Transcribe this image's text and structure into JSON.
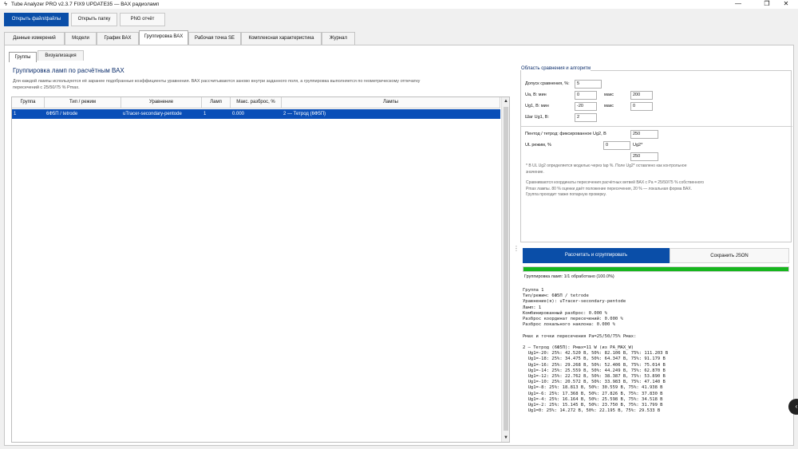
{
  "app": {
    "title": "Tube Analyzer PRO v2.3.7 FIX9 UPDATE35 — ВАХ радиоламп"
  },
  "window_controls": {
    "minimize": "—",
    "maximize": "❐",
    "close": "✕"
  },
  "toolbar": {
    "open_files": "Открыть файл/файлы",
    "open_folder": "Открыть папку",
    "png_report": "PNG отчёт"
  },
  "main_tabs": [
    "Данные измерений",
    "Модели",
    "График ВАХ",
    "Группировка ВАХ",
    "Рабочая точка SE",
    "Комплексная характеристика",
    "Журнал"
  ],
  "sub_tabs": [
    "Группы",
    "Визуализация"
  ],
  "left": {
    "title": "Группировка ламп по расчётным ВАХ",
    "description": "Для каждой лампы используются её заранее подобранные коэффициенты уравнения. ВАХ рассчитываются заново внутри заданного поля, а группировка выполняется по геометрическому отпечатку пересечений с 25/50/75 % Pmax.",
    "table": {
      "headers": [
        "Группа",
        "Тип / режим",
        "Уравнение",
        "Ламп",
        "Макс. разброс, %",
        "Лампы"
      ],
      "rows": [
        [
          "1",
          "6Ф5П / tetrode",
          "uTracer-secondary-pentode",
          "1",
          "0.000",
          "2 — Тетрод (6Ф5П)"
        ]
      ]
    }
  },
  "right": {
    "group_title": "Область сравнения и алгоритм",
    "tolerance_label": "Допуск сравнения, %:",
    "tolerance_value": "5",
    "ua_min_label": "Ua, В: мин",
    "ua_min_value": "0",
    "ua_max_label": "макс",
    "ua_max_value": "200",
    "ug1_min_label": "Ug1, В: мин",
    "ug1_min_value": "-20",
    "ug1_max_label": "макс",
    "ug1_max_value": "0",
    "step_label": "Шаг Ug1, В:",
    "step_value": "2",
    "ug2_label": "Пентод / тетрод: фиксированное Ug2, В",
    "ug2_value": "250",
    "ul_label": "UL режим, %",
    "ul_value": "0",
    "ul_unit": "Ug2*",
    "ul_result": "250",
    "note1": "* В UL Ug2 определяется моделью через tap %. Поле Ug2* оставлено как контрольное значение.",
    "note2": "Сравниваются координаты пересечения расчётных ветвей ВАХ с Pa = 25/50/75 % собственного Pmax лампы. 80 % оценки даёт положение пересечения, 20 % — локальная форма ВАХ. Группа проходит также попарную проверку.",
    "calc_button": "Рассчитать и сгруппировать",
    "save_button": "Сохранить JSON",
    "progress_fraction": 1.0,
    "progress_text": "Группировка ламп: 1/1 обработано (100.0%)",
    "output_lines": [
      "Группа 1",
      "Тип/режим: 6Ф5П / tetrode",
      "Уравнение(я): uTracer-secondary-pentode",
      "Ламп: 1",
      "Комбинированный разброс: 0.000 %",
      "Разброс координат пересечений: 0.000 %",
      "Разброс локального наклона: 0.000 %",
      "",
      "Pмах и точки пересечения Pa=25/50/75% Pмах:",
      "",
      "2 — Тетрод (6Ф5П): Pмах=11 W (из PA_MAX_W)",
      "  Ug1=-20: 25%: 42.520 В, 50%: 82.106 В, 75%: 111.203 В",
      "  Ug1=-18: 25%: 34.475 В, 50%: 64.347 В, 75%: 91.179 В",
      "  Ug1=-16: 25%: 29.268 В, 50%: 52.406 В, 75%: 75.014 В",
      "  Ug1=-14: 25%: 25.559 В, 50%: 44.249 В, 75%: 62.870 В",
      "  Ug1=-12: 25%: 22.762 В, 50%: 38.387 В, 75%: 53.890 В",
      "  Ug1=-10: 25%: 20.572 В, 50%: 33.983 В, 75%: 47.140 В",
      "  Ug1=-8: 25%: 18.813 В, 50%: 30.559 В, 75%: 41.938 В",
      "  Ug1=-6: 25%: 17.368 В, 50%: 27.826 В, 75%: 37.830 В",
      "  Ug1=-4: 25%: 16.164 В, 50%: 25.598 В, 75%: 34.518 В",
      "  Ug1=-2: 25%: 15.145 В, 50%: 23.750 В, 75%: 31.799 В",
      "  Ug1=0: 25%: 14.272 В, 50%: 22.195 В, 75%: 29.533 В"
    ]
  },
  "icons": {
    "app": "tube-icon",
    "scroll_up": "▲",
    "scroll_down": "▼",
    "splitter": "⋮",
    "fab": "‹"
  },
  "colors": {
    "accent": "#0a4ea8",
    "selection": "#0a4fb8",
    "progress": "#17b61e",
    "title_text": "#0b2d6b"
  }
}
